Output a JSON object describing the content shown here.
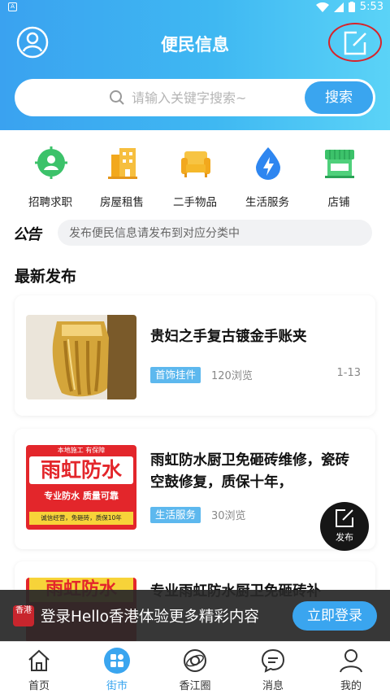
{
  "status_bar": {
    "time": "5:53"
  },
  "header": {
    "title": "便民信息"
  },
  "search": {
    "placeholder": "请输入关键字搜索~",
    "button_label": "搜索"
  },
  "categories": [
    {
      "label": "招聘求职",
      "icon": "recruit-icon",
      "color": "#3cc26a"
    },
    {
      "label": "房屋租售",
      "icon": "building-icon",
      "color": "#f2a81d"
    },
    {
      "label": "二手物品",
      "icon": "sofa-icon",
      "color": "#f5b82a"
    },
    {
      "label": "生活服务",
      "icon": "water-drop-icon",
      "color": "#2e86f0"
    },
    {
      "label": "店铺",
      "icon": "store-icon",
      "color": "#3cc26a"
    }
  ],
  "notice": {
    "tag": "公告",
    "text": "发布便民信息请发布到对应分类中"
  },
  "section": {
    "title": "最新发布"
  },
  "listings": [
    {
      "title": "贵妇之手复古镀金手账夹",
      "tag": "首饰挂件",
      "views": "120浏览",
      "date": "1-13"
    },
    {
      "title": "雨虹防水厨卫免砸砖维修，瓷砖空鼓修复，质保十年，",
      "tag": "生活服务",
      "views": "30浏览",
      "thumb_text": {
        "top": "本地施工 有保障",
        "main": "雨虹防水",
        "sub": "专业防水 质量可靠",
        "foot": "诚信经营，免砸砖，质保10年"
      }
    },
    {
      "title": "专业雨虹防水厨卫免砸砖补",
      "thumb_text": {
        "main": "雨虹防水"
      }
    }
  ],
  "fab": {
    "label": "发布"
  },
  "login_banner": {
    "logo_text": "香港",
    "text": "登录Hello香港体验更多精彩内容",
    "button_label": "立即登录"
  },
  "bottom_nav": [
    {
      "label": "首页",
      "icon": "home-icon"
    },
    {
      "label": "街市",
      "icon": "grid-icon",
      "active": true
    },
    {
      "label": "香江圈",
      "icon": "orbit-icon"
    },
    {
      "label": "消息",
      "icon": "message-icon"
    },
    {
      "label": "我的",
      "icon": "profile-icon"
    }
  ],
  "colors": {
    "accent": "#3aa5ef",
    "header_start": "#3aa2f0",
    "header_end": "#5bd3f7",
    "highlight_ring": "#d8232a"
  }
}
